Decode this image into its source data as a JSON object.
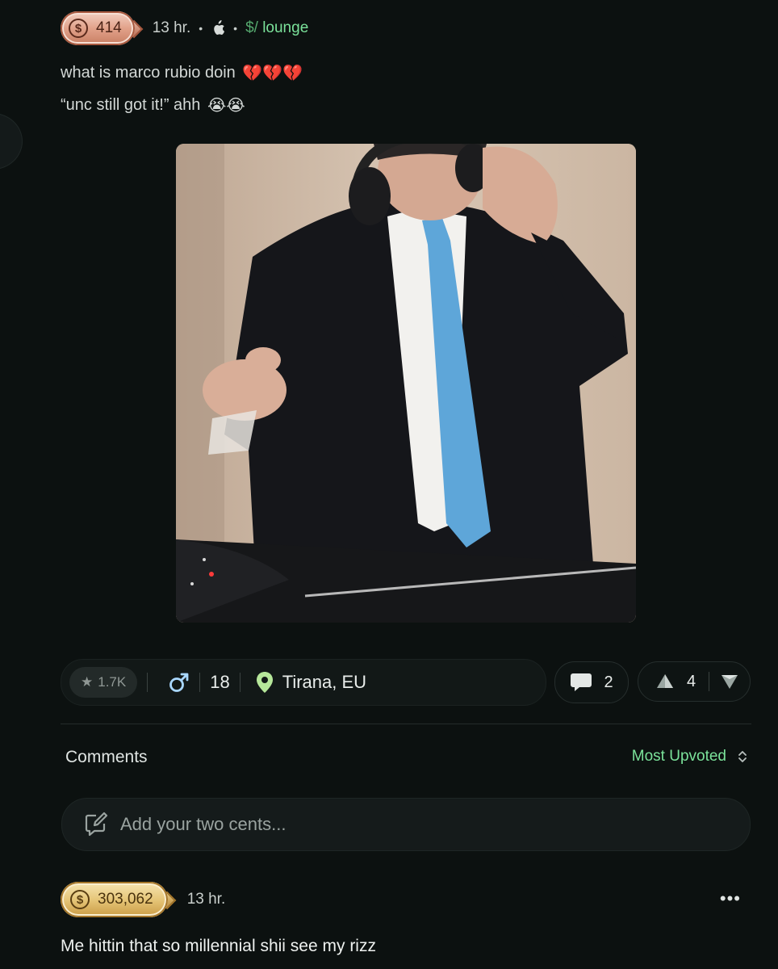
{
  "post": {
    "coins": "414",
    "time": "13 hr.",
    "separator": "•",
    "platform_icon": "apple-icon",
    "community_prefix": "$/",
    "community_name": "lounge",
    "line1": "what is marco rubio doin",
    "line1_emoji": "💔💔💔",
    "line2": "“unc still got it!” ahh",
    "line2_emoji": "😭😭"
  },
  "stats": {
    "rating": "1.7K",
    "age": "18",
    "location": "Tirana, EU",
    "comments": "2",
    "votes": "4"
  },
  "comments_section": {
    "title": "Comments",
    "sort": "Most Upvoted",
    "input_placeholder": "Add your two cents..."
  },
  "comment": {
    "coins": "303,062",
    "time": "13 hr.",
    "more": "•••",
    "text": "Me hittin that so millennial shii see my rizz"
  },
  "colors": {
    "background": "#0c1110",
    "accent_green": "#7be29a",
    "bronze": "#e2a28a",
    "gold": "#e6c679"
  }
}
